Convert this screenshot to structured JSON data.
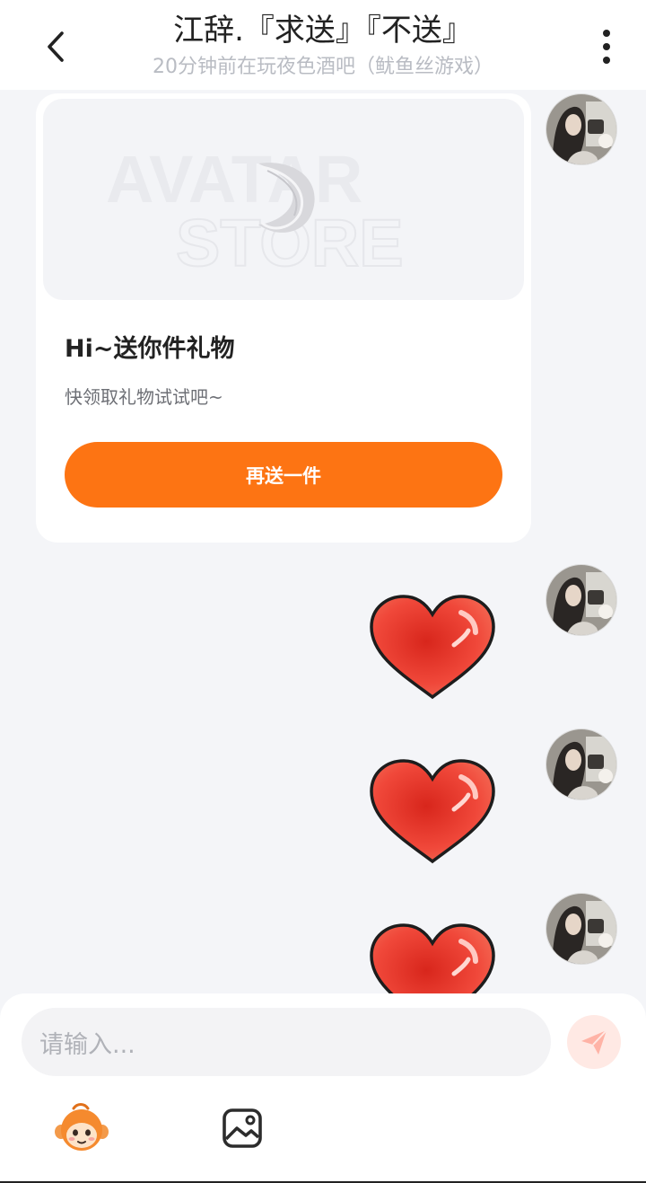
{
  "header": {
    "title": "江辞.『求送』『不送』",
    "subtitle": "20分钟前在玩夜色酒吧（鱿鱼丝游戏）",
    "back_icon": "chevron-left-icon",
    "more_icon": "more-vertical-icon"
  },
  "gift_card": {
    "image_watermark_line1": "AVATAR",
    "image_watermark_line2": "STORE",
    "title": "Hi~送你件礼物",
    "description": "快领取礼物试试吧~",
    "button_label": "再送一件",
    "button_color": "#fd7413"
  },
  "messages": [
    {
      "type": "gift-card",
      "sender": "self"
    },
    {
      "type": "sticker",
      "sticker": "heart",
      "sender": "self"
    },
    {
      "type": "sticker",
      "sticker": "heart",
      "sender": "self"
    },
    {
      "type": "sticker",
      "sticker": "heart",
      "sender": "self"
    }
  ],
  "input": {
    "placeholder": "请输入...",
    "send_icon": "paper-plane-icon",
    "emoji_icon": "monkey-emoji-icon",
    "image_icon": "image-icon"
  },
  "colors": {
    "accent": "#fd7413",
    "heart": "#e8392b",
    "send_bg": "#ffe9e4"
  }
}
